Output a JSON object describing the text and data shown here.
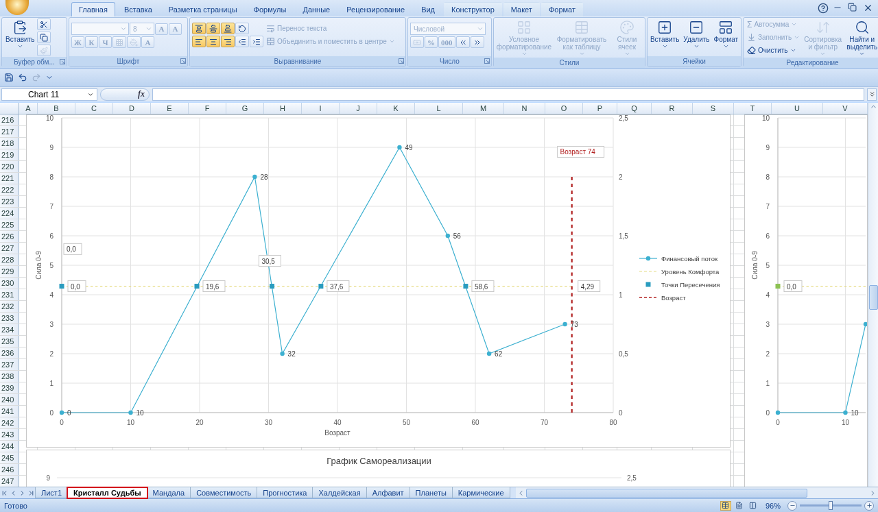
{
  "ribbon_tabs": [
    {
      "label": "Главная",
      "selected": true,
      "kind": "main"
    },
    {
      "label": "Вставка",
      "selected": false,
      "kind": "main"
    },
    {
      "label": "Разметка страницы",
      "selected": false,
      "kind": "main"
    },
    {
      "label": "Формулы",
      "selected": false,
      "kind": "main"
    },
    {
      "label": "Данные",
      "selected": false,
      "kind": "main"
    },
    {
      "label": "Рецензирование",
      "selected": false,
      "kind": "main"
    },
    {
      "label": "Вид",
      "selected": false,
      "kind": "main"
    },
    {
      "label": "Конструктор",
      "selected": false,
      "kind": "context"
    },
    {
      "label": "Макет",
      "selected": false,
      "kind": "context"
    },
    {
      "label": "Формат",
      "selected": false,
      "kind": "context"
    }
  ],
  "ribbon_groups": [
    {
      "label": "Буфер обм...",
      "launcher": true,
      "columns": [
        {
          "kind": "large",
          "label": "Вставить",
          "menu": true,
          "disabled": false
        },
        {
          "kind": "stack",
          "rows": [
            [
              {
                "kind": "icon",
                "disabled": false
              }
            ],
            [
              {
                "kind": "icon",
                "disabled": false
              }
            ],
            [
              {
                "kind": "icon",
                "disabled": true
              }
            ]
          ]
        }
      ]
    },
    {
      "label": "Шрифт",
      "launcher": true,
      "columns": [
        {
          "kind": "stack",
          "rows": [
            [
              {
                "kind": "combo",
                "disabled": true
              },
              {
                "kind": "combo",
                "value": "8",
                "disabled": true
              },
              {
                "kind": "glyph",
                "label": "A",
                "disabled": true
              },
              {
                "kind": "glyph",
                "label": "A",
                "disabled": true
              }
            ],
            [
              {
                "kind": "glyph",
                "label": "Ж",
                "disabled": true
              },
              {
                "kind": "glyph",
                "label": "К",
                "disabled": true
              },
              {
                "kind": "glyph",
                "label": "Ч",
                "disabled": true
              },
              {
                "kind": "icon",
                "disabled": true
              },
              {
                "kind": "icon",
                "disabled": true
              },
              {
                "kind": "glyph",
                "label": "A",
                "disabled": true
              }
            ]
          ]
        }
      ]
    },
    {
      "label": "Выравнивание",
      "launcher": true,
      "columns": [
        {
          "kind": "stack",
          "rows": [
            [
              {
                "kind": "icon",
                "disabled": false,
                "selected": true
              },
              {
                "kind": "icon",
                "disabled": false,
                "selected": true
              },
              {
                "kind": "icon",
                "disabled": false,
                "selected": true
              },
              {
                "kind": "icon",
                "disabled": false,
                "selected": false
              }
            ],
            [
              {
                "kind": "icon",
                "disabled": false,
                "selected": true
              },
              {
                "kind": "icon",
                "disabled": false,
                "selected": true
              },
              {
                "kind": "icon",
                "disabled": false,
                "selected": true
              },
              {
                "kind": "icon",
                "disabled": false,
                "selected": false
              },
              {
                "kind": "icon",
                "disabled": false,
                "selected": false
              }
            ]
          ]
        },
        {
          "kind": "stack",
          "rows": [
            [
              {
                "kind": "text",
                "label": "Перенос текста",
                "disabled": true
              }
            ],
            [
              {
                "kind": "text",
                "label": "Объединить и поместить в центре",
                "disabled": true,
                "menu": true
              }
            ]
          ]
        }
      ]
    },
    {
      "label": "Число",
      "launcher": true,
      "columns": [
        {
          "kind": "stack",
          "rows": [
            [
              {
                "kind": "combo",
                "value": "Числовой",
                "disabled": true
              }
            ],
            [
              {
                "kind": "icon",
                "disabled": true
              },
              {
                "kind": "glyph",
                "label": "%",
                "disabled": true
              },
              {
                "kind": "glyph",
                "label": "000",
                "disabled": true
              },
              {
                "kind": "icon",
                "disabled": false
              },
              {
                "kind": "icon",
                "disabled": false
              }
            ]
          ]
        }
      ]
    },
    {
      "label": "Стили",
      "launcher": false,
      "columns": [
        {
          "kind": "large",
          "label": "Условное форматирование",
          "menu": true,
          "disabled": true
        },
        {
          "kind": "large",
          "label": "Форматировать как таблицу",
          "menu": true,
          "disabled": true
        },
        {
          "kind": "large",
          "label": "Стили ячеек",
          "menu": true,
          "disabled": true
        }
      ]
    },
    {
      "label": "Ячейки",
      "launcher": false,
      "columns": [
        {
          "kind": "large",
          "label": "Вставить",
          "menu": true,
          "disabled": false
        },
        {
          "kind": "large",
          "label": "Удалить",
          "menu": true,
          "disabled": false
        },
        {
          "kind": "large",
          "label": "Формат",
          "menu": true,
          "disabled": false
        }
      ]
    },
    {
      "label": "Редактирование",
      "launcher": false,
      "columns": [
        {
          "kind": "stack",
          "rows": [
            [
              {
                "kind": "text",
                "glyph": "Σ",
                "label": "Автосумма",
                "disabled": true,
                "menu": true
              }
            ],
            [
              {
                "kind": "text",
                "label": "Заполнить",
                "disabled": true,
                "menu": true
              }
            ],
            [
              {
                "kind": "text",
                "label": "Очистить",
                "disabled": false,
                "menu": true
              }
            ]
          ]
        },
        {
          "kind": "large",
          "label": "Сортировка и фильтр",
          "menu": true,
          "disabled": true
        },
        {
          "kind": "large",
          "label": "Найти и выделить",
          "menu": true,
          "disabled": false
        }
      ]
    }
  ],
  "formula_bar": {
    "name_box": "Chart 11",
    "function_label": "fx"
  },
  "sheet": {
    "columns": [
      "A",
      "B",
      "C",
      "D",
      "E",
      "F",
      "G",
      "H",
      "I",
      "J",
      "K",
      "L",
      "M",
      "N",
      "O",
      "P",
      "Q",
      "R",
      "S",
      "T",
      "U",
      "V"
    ],
    "rows": [
      "216",
      "217",
      "218",
      "219",
      "220",
      "221",
      "222",
      "223",
      "224",
      "225",
      "226",
      "227",
      "228",
      "229",
      "230",
      "231",
      "232",
      "233",
      "234",
      "235",
      "236",
      "237",
      "238",
      "239",
      "240",
      "241",
      "242",
      "243",
      "244",
      "245",
      "246",
      "247"
    ]
  },
  "charts": [
    {
      "chart_data": {
        "type": "line",
        "xlabel": "Возраст",
        "ylabel": "Сила 0-9",
        "xlim": [
          0,
          80
        ],
        "ylim": [
          0,
          10
        ],
        "y2lim": [
          0,
          2.5
        ],
        "grid": true,
        "legend": true,
        "xticks": [
          0,
          10,
          20,
          30,
          40,
          50,
          60,
          70,
          80
        ],
        "yticks": [
          0,
          1,
          2,
          3,
          4,
          5,
          6,
          7,
          8,
          9,
          10
        ],
        "y2ticks": [
          {
            "value": 0,
            "label": "0"
          },
          {
            "value": 0.5,
            "label": "0,5"
          },
          {
            "value": 1,
            "label": "1"
          },
          {
            "value": 1.5,
            "label": "1,5"
          },
          {
            "value": 2,
            "label": "2"
          },
          {
            "value": 2.5,
            "label": "2,5"
          }
        ],
        "series": [
          {
            "name": "Финансовый поток",
            "color": "#3cb0d0",
            "marker": "circle",
            "line_style": "solid",
            "x": [
              0,
              10,
              28,
              32,
              49,
              56,
              62,
              73
            ],
            "values": [
              0,
              0,
              8,
              2,
              9,
              6,
              2,
              3
            ]
          },
          {
            "name": "Уровень Комфорта",
            "color": "#e6dc84",
            "line_style": "dashed",
            "x": [
              0,
              74
            ],
            "values": [
              4.29,
              4.29
            ]
          },
          {
            "name": "Точки Пересечения",
            "color": "#2a9cbf",
            "type": "scatter",
            "marker": "square",
            "x": [
              0,
              19.6,
              30.5,
              37.6,
              58.6
            ],
            "values": [
              4.29,
              4.29,
              4.29,
              4.29,
              4.29
            ]
          },
          {
            "name": "Возраст",
            "color": "#b22222",
            "line_style": "dashed",
            "axis": "y2",
            "x": [
              74,
              74
            ],
            "values": [
              0,
              2
            ]
          }
        ],
        "annotations": [
          {
            "text": "0",
            "x": 0,
            "y": 0
          },
          {
            "text": "10",
            "x": 10,
            "y": 0
          },
          {
            "text": "28",
            "x": 28,
            "y": 8
          },
          {
            "text": "32",
            "x": 32,
            "y": 2
          },
          {
            "text": "49",
            "x": 49,
            "y": 9
          },
          {
            "text": "56",
            "x": 56,
            "y": 6
          },
          {
            "text": "62",
            "x": 62,
            "y": 2
          },
          {
            "text": "73",
            "x": 73,
            "y": 3
          },
          "0,0",
          {
            "text": "0,0",
            "x": 0,
            "y": 4.29
          },
          {
            "text": "19,6",
            "x": 19.6,
            "y": 4.29
          },
          "30,5",
          {
            "text": "37,6",
            "x": 37.6,
            "y": 4.29
          },
          {
            "text": "58,6",
            "x": 58.6,
            "y": 4.29
          },
          {
            "text": "4,29",
            "x": 74,
            "y": 4.29
          },
          "Возраст 74"
        ]
      }
    },
    {
      "chart_data": {
        "type": "line",
        "ylabel": "Сила 0-9",
        "xlim": [
          0,
          13
        ],
        "ylim": [
          0,
          10
        ],
        "grid": true,
        "xticks": [
          0,
          10
        ],
        "yticks": [
          0,
          1,
          2,
          3,
          4,
          5,
          6,
          7,
          8,
          9,
          10
        ],
        "series": [
          {
            "color": "#3cb0d0",
            "marker": "circle",
            "line_style": "solid",
            "x": [
              0,
              10,
              13
            ],
            "values": [
              0,
              0,
              3
            ]
          },
          {
            "color": "#e6dc84",
            "line_style": "dashed",
            "x": [
              0,
              13
            ],
            "values": [
              4.29,
              4.29
            ]
          },
          {
            "color": "#8cc152",
            "type": "scatter",
            "marker": "square",
            "x": [
              0
            ],
            "values": [
              4.29
            ]
          }
        ],
        "annotations": [
          {
            "text": "10",
            "x": 10,
            "y": 0
          },
          {
            "text": "0,0",
            "x": 0,
            "y": 4.29
          }
        ]
      }
    }
  ],
  "lower_chart": {
    "title": "График Самореализации",
    "left_axis_value": "9",
    "right_axis_value": "2,5"
  },
  "sheet_tabs": [
    {
      "label": "Лист1",
      "selected": false
    },
    {
      "label": "Кристалл Судьбы",
      "selected": true
    },
    {
      "label": "Мандала",
      "selected": false
    },
    {
      "label": "Совместимость",
      "selected": false
    },
    {
      "label": "Прогностика",
      "selected": false
    },
    {
      "label": "Халдейская",
      "selected": false
    },
    {
      "label": "Алфавит",
      "selected": false
    },
    {
      "label": "Планеты",
      "selected": false
    },
    {
      "label": "Кармические",
      "selected": false
    }
  ],
  "status_bar": {
    "text": "Готово",
    "views": [
      {
        "selected": true
      },
      {
        "selected": false
      },
      {
        "selected": false
      }
    ],
    "zoom": "96%",
    "zoom_slider": {
      "level": 0.5
    }
  }
}
